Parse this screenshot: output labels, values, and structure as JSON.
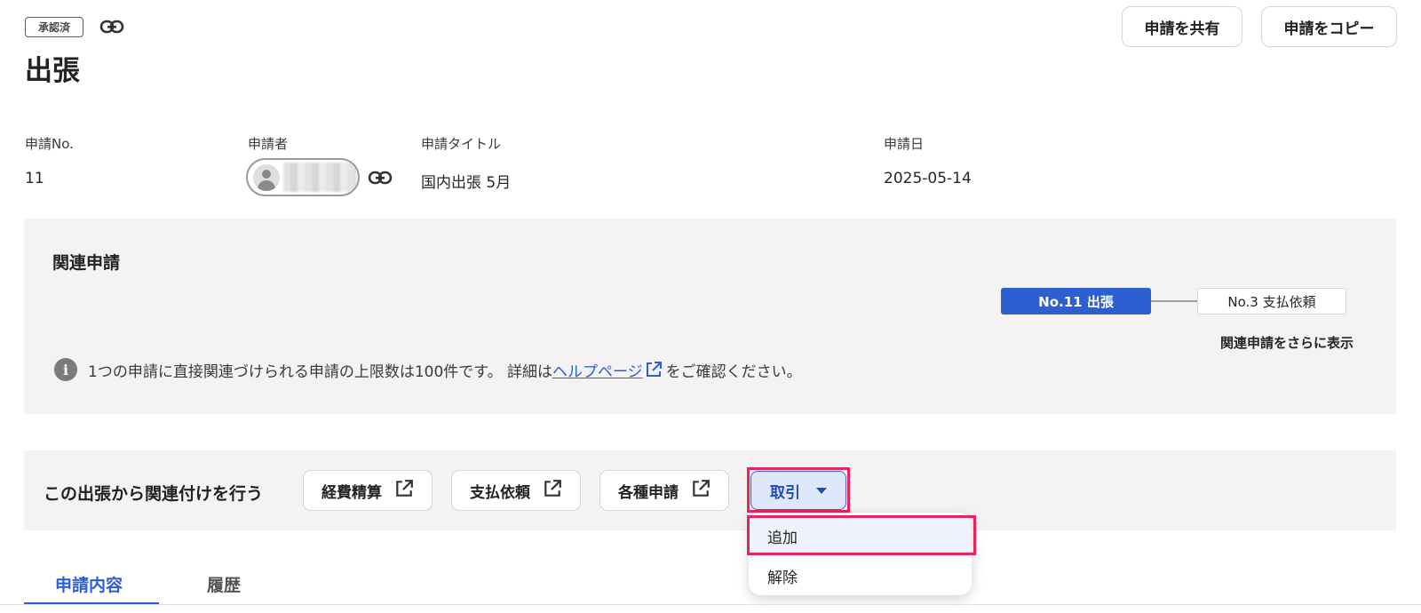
{
  "header": {
    "status_badge": "承認済",
    "title": "出張",
    "share_button": "申請を共有",
    "copy_button": "申請をコピー"
  },
  "meta": {
    "number_label": "申請No.",
    "number_value": "11",
    "applicant_label": "申請者",
    "title_label": "申請タイトル",
    "title_value": "国内出張 5月",
    "date_label": "申請日",
    "date_value": "2025-05-14"
  },
  "related": {
    "heading": "関連申請",
    "current_node": "No.11 出張",
    "linked_node": "No.3 支払依頼",
    "show_more": "関連申請をさらに表示",
    "info_text_before": "1つの申請に直接関連づけられる申請の上限数は100件です。 詳細は",
    "help_link": "ヘルプページ",
    "info_text_after": "をご確認ください。"
  },
  "actions": {
    "label": "この出張から関連付けを行う",
    "expense_button": "経費精算",
    "payment_button": "支払依頼",
    "misc_button": "各種申請",
    "transaction_button": "取引",
    "dropdown": [
      {
        "label": "追加"
      },
      {
        "label": "解除"
      }
    ]
  },
  "tabs": [
    {
      "label": "申請内容"
    },
    {
      "label": "履歴"
    }
  ],
  "colors": {
    "accent": "#2d5fd0",
    "highlight": "#e8245b",
    "panel": "#f4f2f3"
  }
}
